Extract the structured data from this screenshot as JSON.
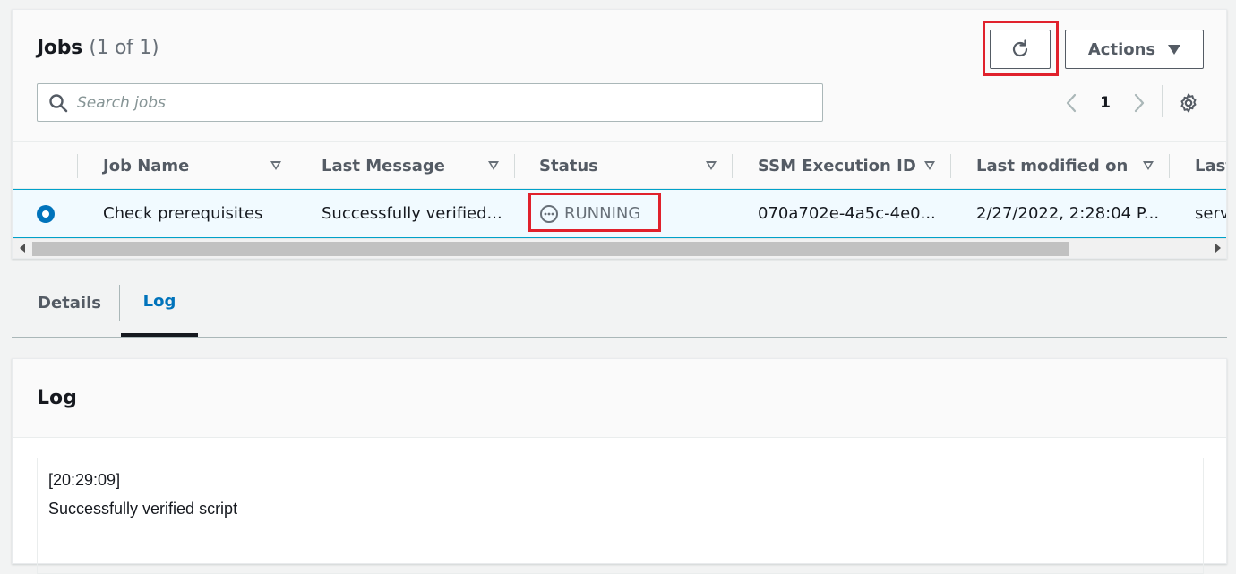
{
  "jobs": {
    "title": "Jobs",
    "count": "(1 of 1)",
    "actions_label": "Actions",
    "search_placeholder": "Search jobs",
    "page": "1",
    "columns": [
      "Job Name",
      "Last Message",
      "Status",
      "SSM Execution ID",
      "Last modified on",
      "Last"
    ],
    "rows": [
      {
        "job_name": "Check prerequisites",
        "last_message": "Successfully verified...",
        "status": "RUNNING",
        "ssm_execution_id": "070a702e-4a5c-4e0...",
        "last_modified_on": "2/27/2022, 2:28:04 P...",
        "last": "serv"
      }
    ]
  },
  "tabs": [
    {
      "label": "Details"
    },
    {
      "label": "Log"
    }
  ],
  "log": {
    "title": "Log",
    "lines": [
      "[20:29:09]",
      "Successfully verified script"
    ]
  },
  "colors": {
    "accent": "#0073bb",
    "highlight": "#e0212c",
    "selected_row": "#f1faff"
  },
  "icons": [
    "search-icon",
    "refresh-icon",
    "caret-down-icon",
    "chevron-left-icon",
    "chevron-right-icon",
    "gear-icon",
    "sort-icon",
    "status-running-icon"
  ]
}
